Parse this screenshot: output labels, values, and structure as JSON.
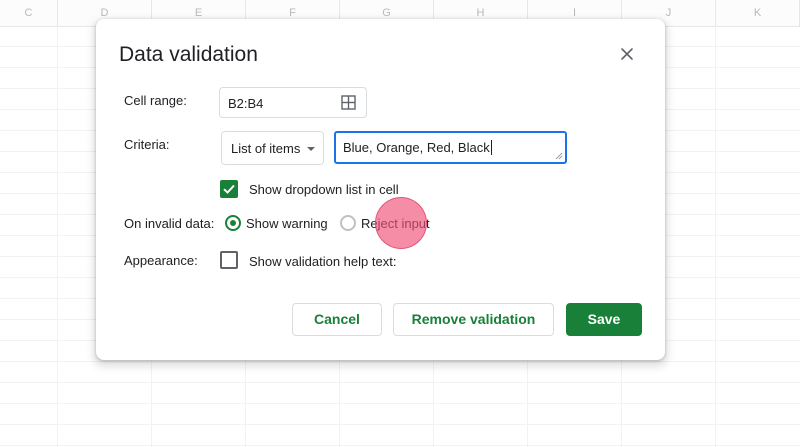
{
  "sheet": {
    "columns": [
      "C",
      "D",
      "E",
      "F",
      "G",
      "H",
      "I",
      "J",
      "K"
    ]
  },
  "dialog": {
    "title": "Data validation",
    "cell_range": {
      "label": "Cell range:",
      "value": "B2:B4",
      "icon": "grid-select-icon"
    },
    "criteria": {
      "label": "Criteria:",
      "type_selected": "List of items",
      "items_value": "Blue, Orange, Red, Black",
      "show_dropdown": {
        "label": "Show dropdown list in cell",
        "checked": true
      }
    },
    "on_invalid": {
      "label": "On invalid data:",
      "options": [
        {
          "label": "Show warning",
          "selected": true
        },
        {
          "label": "Reject input",
          "selected": false
        }
      ]
    },
    "appearance": {
      "label": "Appearance:",
      "help_text": {
        "label": "Show validation help text:",
        "checked": false
      }
    },
    "buttons": {
      "cancel": "Cancel",
      "remove": "Remove validation",
      "save": "Save"
    }
  },
  "colors": {
    "accent_green": "#188038",
    "focus_blue": "#1a73e8",
    "click_indicator": "#f05078"
  }
}
